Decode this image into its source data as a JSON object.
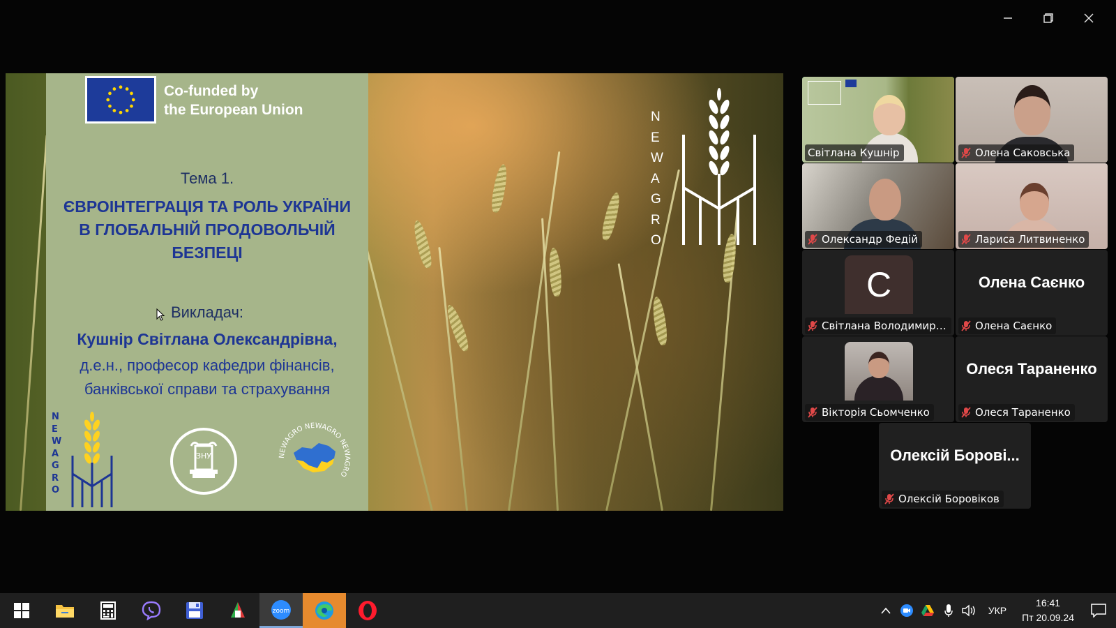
{
  "window": {
    "minimize_label": "minimize",
    "restore_label": "restore",
    "close_label": "close"
  },
  "slide": {
    "eu_line1": "Co-funded by",
    "eu_line2": "the European Union",
    "topic": "Тема 1.",
    "title_lines": [
      "ЄВРОІНТЕГРАЦІЯ ТА РОЛЬ УКРАЇНИ",
      "В ГЛОБАЛЬНІЙ ПРОДОВОЛЬЧІЙ",
      "БЕЗПЕЦІ"
    ],
    "lecturer_label": "Викладач:",
    "lecturer_name": "Кушнір Світлана Олександрівна,",
    "lecturer_pos_lines": [
      "д.е.н., професор кафедри фінансів,",
      "банківської справи та страхування"
    ],
    "brand_letters": [
      "N",
      "E",
      "W",
      "A",
      "G",
      "R",
      "O"
    ],
    "seal_text": "ЗНУ",
    "map_ring_text": "NEWAGRO NEWAGRO NEWAGRO"
  },
  "participants": [
    {
      "name": "Світлана Кушнір",
      "muted": false,
      "active": true
    },
    {
      "name": "Олена Саковська",
      "muted": true
    },
    {
      "name": "Олександр Федій",
      "muted": true
    },
    {
      "name": "Лариса Литвиненко",
      "muted": true
    },
    {
      "name": "Світлана Володимирівн...",
      "muted": true,
      "avatar_letter": "C"
    },
    {
      "name": "Олена Саєнко",
      "muted": true,
      "big_name": "Олена Саєнко"
    },
    {
      "name": "Вікторія Сьомченко",
      "muted": true
    },
    {
      "name": "Олеся Тараненко",
      "muted": true,
      "big_name": "Олеся Тараненко"
    },
    {
      "name": "Олексій Боровіков",
      "muted": true,
      "big_name": "Олексій Борові..."
    }
  ],
  "taskbar": {
    "apps": [
      "start-icon",
      "file-explorer-icon",
      "calculator-icon",
      "viber-icon",
      "save-disk-icon",
      "pdf-reader-icon",
      "zoom-icon",
      "edge-icon",
      "opera-icon"
    ],
    "zoom_label": "zoom",
    "language": "УКР",
    "time": "16:41",
    "date": "Пт 20.09.24",
    "colors": {
      "accent": "#7fa7d8",
      "active_speaker": "#23d26e",
      "mute": "#e04848"
    }
  }
}
